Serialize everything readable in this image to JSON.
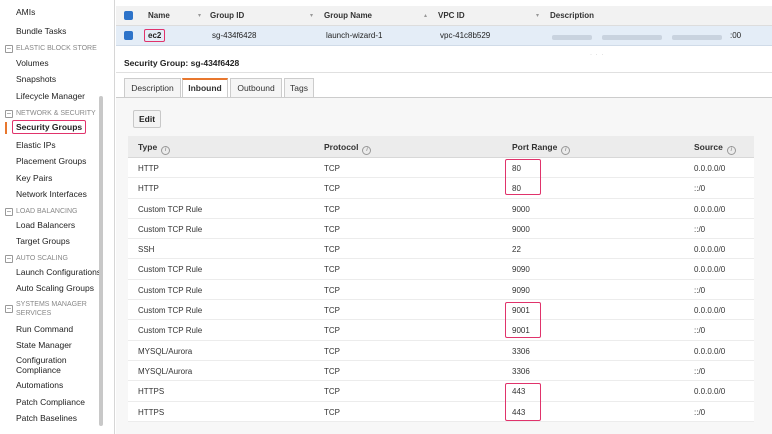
{
  "sidebar": {
    "items_top": [
      "AMIs",
      "Bundle Tasks"
    ],
    "sections": [
      {
        "title": "ELASTIC BLOCK STORE",
        "items": [
          "Volumes",
          "Snapshots",
          "Lifecycle Manager"
        ]
      },
      {
        "title": "NETWORK & SECURITY",
        "items": [
          "Security Groups",
          "Elastic IPs",
          "Placement Groups",
          "Key Pairs",
          "Network Interfaces"
        ]
      },
      {
        "title": "LOAD BALANCING",
        "items": [
          "Load Balancers",
          "Target Groups"
        ]
      },
      {
        "title": "AUTO SCALING",
        "items": [
          "Launch Configurations",
          "Auto Scaling Groups"
        ]
      },
      {
        "title": "SYSTEMS MANAGER SERVICES",
        "items": [
          "Run Command",
          "State Manager",
          "Configuration Compliance",
          "Automations",
          "Patch Compliance",
          "Patch Baselines"
        ]
      }
    ],
    "active_item": "Security Groups"
  },
  "groups_table": {
    "headers": [
      "Name",
      "Group ID",
      "Group Name",
      "VPC ID",
      "Description"
    ],
    "row": {
      "name": "ec2",
      "group_id": "sg-434f6428",
      "group_name": "launch-wizard-1",
      "vpc_id": "vpc-41c8b529",
      "description_tail": ":00"
    }
  },
  "detail": {
    "title": "Security Group: sg-434f6428",
    "tabs": [
      "Description",
      "Inbound",
      "Outbound",
      "Tags"
    ],
    "active_tab": "Inbound",
    "edit_label": "Edit"
  },
  "rules_table": {
    "headers": [
      "Type",
      "Protocol",
      "Port Range",
      "Source"
    ],
    "info_glyph": "i",
    "rows": [
      [
        "HTTP",
        "TCP",
        "80",
        "0.0.0.0/0"
      ],
      [
        "HTTP",
        "TCP",
        "80",
        "::/0"
      ],
      [
        "Custom TCP Rule",
        "TCP",
        "9000",
        "0.0.0.0/0"
      ],
      [
        "Custom TCP Rule",
        "TCP",
        "9000",
        "::/0"
      ],
      [
        "SSH",
        "TCP",
        "22",
        "0.0.0.0/0"
      ],
      [
        "Custom TCP Rule",
        "TCP",
        "9090",
        "0.0.0.0/0"
      ],
      [
        "Custom TCP Rule",
        "TCP",
        "9090",
        "::/0"
      ],
      [
        "Custom TCP Rule",
        "TCP",
        "9001",
        "0.0.0.0/0"
      ],
      [
        "Custom TCP Rule",
        "TCP",
        "9001",
        "::/0"
      ],
      [
        "MYSQL/Aurora",
        "TCP",
        "3306",
        "0.0.0.0/0"
      ],
      [
        "MYSQL/Aurora",
        "TCP",
        "3306",
        "::/0"
      ],
      [
        "HTTPS",
        "TCP",
        "443",
        "0.0.0.0/0"
      ],
      [
        "HTTPS",
        "TCP",
        "443",
        "::/0"
      ]
    ]
  },
  "colors": {
    "accent": "#e8772e",
    "highlight": "#e0336b",
    "checkbox": "#2d73c9"
  }
}
